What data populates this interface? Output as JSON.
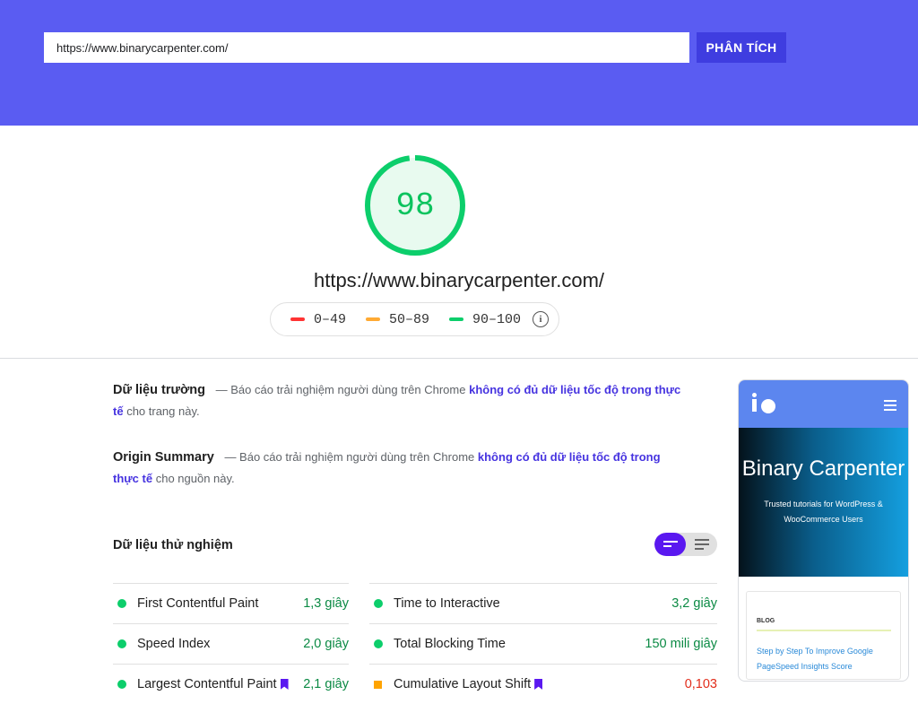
{
  "search": {
    "url_value": "https://www.binarycarpenter.com/",
    "analyze_label": "PHÂN TÍCH"
  },
  "score": {
    "value": "98",
    "value_fraction": 0.98,
    "url": "https://www.binarycarpenter.com/"
  },
  "legend": {
    "items": [
      {
        "label": "0–49",
        "color": "#ff3333"
      },
      {
        "label": "50–89",
        "color": "#ffaa33"
      },
      {
        "label": "90–100",
        "color": "#0cce6b"
      }
    ]
  },
  "field_data": {
    "title": "Dữ liệu trường",
    "dash_text": "— Báo cáo trải nghiệm người dùng trên Chrome",
    "link_text": "không có đủ dữ liệu tốc độ trong thực tế",
    "suffix": "cho trang này."
  },
  "origin_summary": {
    "title": "Origin Summary",
    "dash_text": "— Báo cáo trải nghiệm người dùng trên Chrome",
    "link_text": "không có đủ dữ liệu tốc độ trong thực tế",
    "suffix": "cho nguồn này."
  },
  "lab_data": {
    "title": "Dữ liệu thử nghiệm",
    "left_metrics": [
      {
        "name": "First Contentful Paint",
        "value": "1,3 giây",
        "status": "good"
      },
      {
        "name": "Speed Index",
        "value": "2,0 giây",
        "status": "good"
      },
      {
        "name": "Largest Contentful Paint",
        "value": "2,1 giây",
        "status": "good"
      }
    ],
    "right_metrics": [
      {
        "name": "Time to Interactive",
        "value": "3,2 giây",
        "status": "good"
      },
      {
        "name": "Total Blocking Time",
        "value": "150 mili giây",
        "status": "good"
      },
      {
        "name": "Cumulative Layout Shift",
        "value": "0,103",
        "status": "average"
      }
    ]
  },
  "preview": {
    "hero_title": "Binary Carpenter",
    "hero_subtitle": "Trusted tutorials for WordPress & WooCommerce Users",
    "blog_label": "BLOG",
    "post_link": "Step by Step To Improve Google PageSpeed Insights Score"
  },
  "colors": {
    "header_bg": "#5a5cf2",
    "button_bg": "#3f3de0",
    "score_green": "#0cce6b",
    "link": "#4633e0",
    "bookmark": "#5a18f0"
  }
}
